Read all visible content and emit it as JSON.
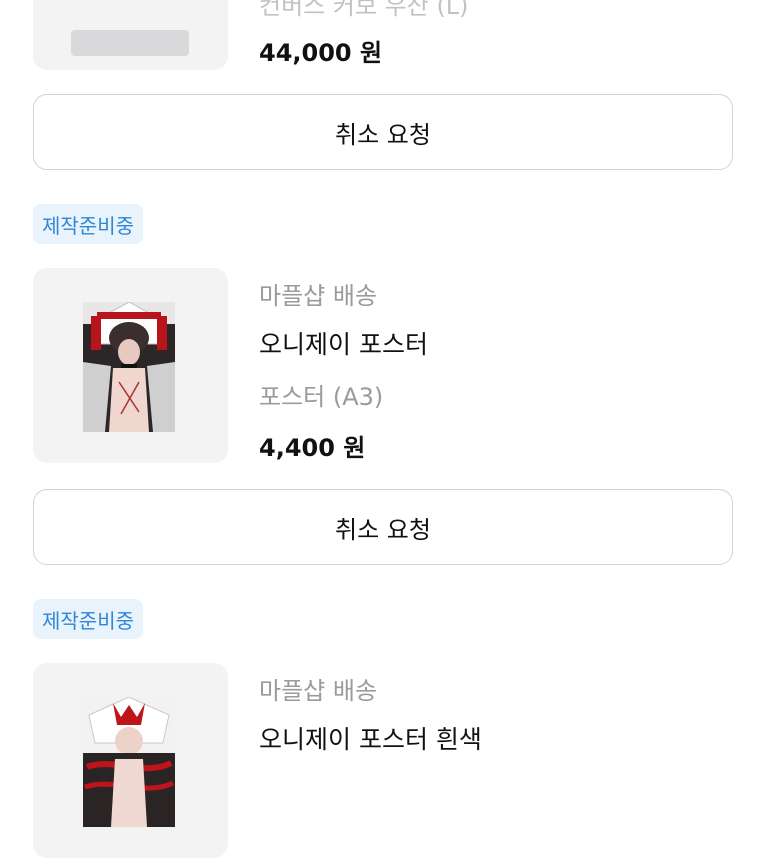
{
  "items": [
    {
      "option_partial": "컨버스 커보 우산 (L)",
      "price": "44,000 원",
      "cancel_label": "취소 요청"
    },
    {
      "status_badge": "제작준비중",
      "shipping": "마플샵 배송",
      "name": "오니제이 포스터",
      "option": "포스터 (A3)",
      "price": "4,400 원",
      "cancel_label": "취소 요청"
    },
    {
      "status_badge": "제작준비중",
      "shipping": "마플샵 배송",
      "name": "오니제이 포스터 흰색"
    }
  ]
}
